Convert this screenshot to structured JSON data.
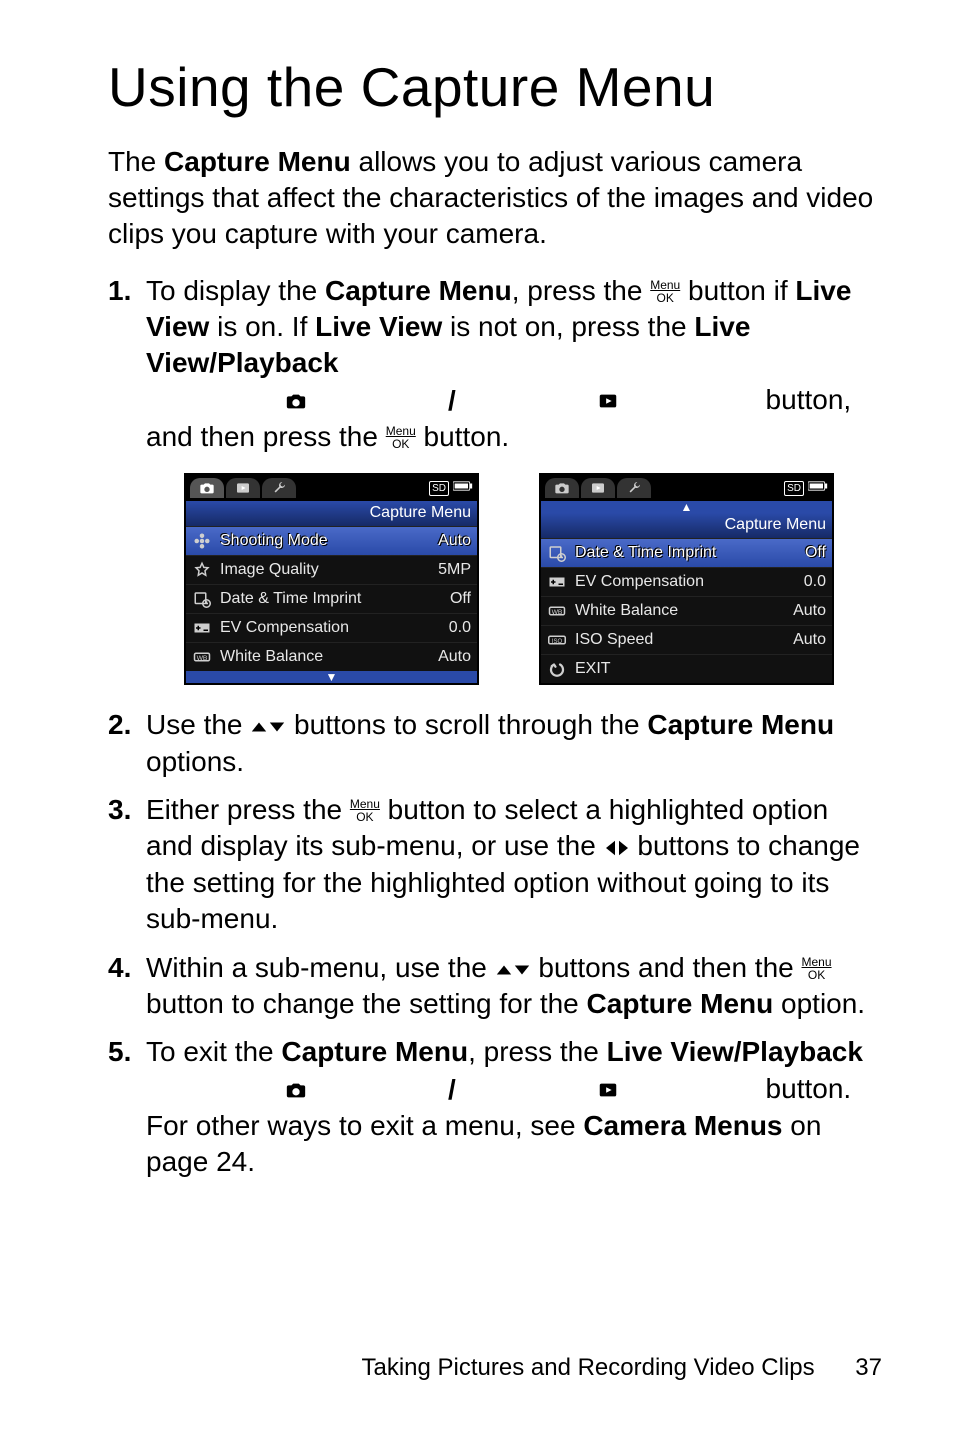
{
  "title": "Using the Capture Menu",
  "intro_parts": {
    "p1": "The ",
    "b1": "Capture Menu",
    "p2": " allows you to adjust various camera settings that affect the characteristics of the images and video clips you capture with your camera."
  },
  "steps": {
    "s1": {
      "a": "To display the ",
      "b": "Capture Menu",
      "c": ", press the ",
      "d": " button if ",
      "e": "Live View",
      "f": " is on. If ",
      "g": "Live View",
      "h": " is not on, press the ",
      "i": "Live View/Playback",
      "j": " button, and then press the ",
      "k": " button."
    },
    "s2": {
      "a": "Use the ",
      "b": " buttons to scroll through the ",
      "c": "Capture Menu",
      "d": " options."
    },
    "s3": {
      "a": "Either press the ",
      "b": " button to select a highlighted option and display its sub-menu, or use the ",
      "c": " buttons to change the setting for the highlighted option without going to its sub-menu."
    },
    "s4": {
      "a": "Within a sub-menu, use the ",
      "b": " buttons and then the ",
      "c": " button to change the setting for the ",
      "d": "Capture Menu",
      "e": " option."
    },
    "s5": {
      "a": "To exit the ",
      "b": "Capture Menu",
      "c": ", press the ",
      "d": "Live View/Playback",
      "e": " button. For other ways to exit a menu, see ",
      "f": "Camera Menus",
      "g": " on page 24."
    }
  },
  "menu_ok": {
    "top": "Menu",
    "bot": "OK"
  },
  "sd_label": "SD",
  "shots": {
    "title": "Capture Menu",
    "left": [
      {
        "icon": "flower",
        "label": "Shooting Mode",
        "value": "Auto",
        "hl": true
      },
      {
        "icon": "star",
        "label": "Image Quality",
        "value": "5MP",
        "hl": false
      },
      {
        "icon": "dateimp",
        "label": "Date & Time Imprint",
        "value": "Off",
        "hl": false
      },
      {
        "icon": "ev",
        "label": "EV Compensation",
        "value": "0.0",
        "hl": false
      },
      {
        "icon": "wb",
        "label": "White Balance",
        "value": "Auto",
        "hl": false
      }
    ],
    "right": [
      {
        "icon": "dateimp",
        "label": "Date & Time Imprint",
        "value": "Off",
        "hl": true
      },
      {
        "icon": "ev",
        "label": "EV Compensation",
        "value": "0.0",
        "hl": false
      },
      {
        "icon": "wb",
        "label": "White Balance",
        "value": "Auto",
        "hl": false
      },
      {
        "icon": "iso",
        "label": "ISO Speed",
        "value": "Auto",
        "hl": false
      },
      {
        "icon": "exit",
        "label": "EXIT",
        "value": "",
        "hl": false
      }
    ]
  },
  "footer": {
    "text": "Taking Pictures and Recording Video Clips",
    "page": "37"
  }
}
